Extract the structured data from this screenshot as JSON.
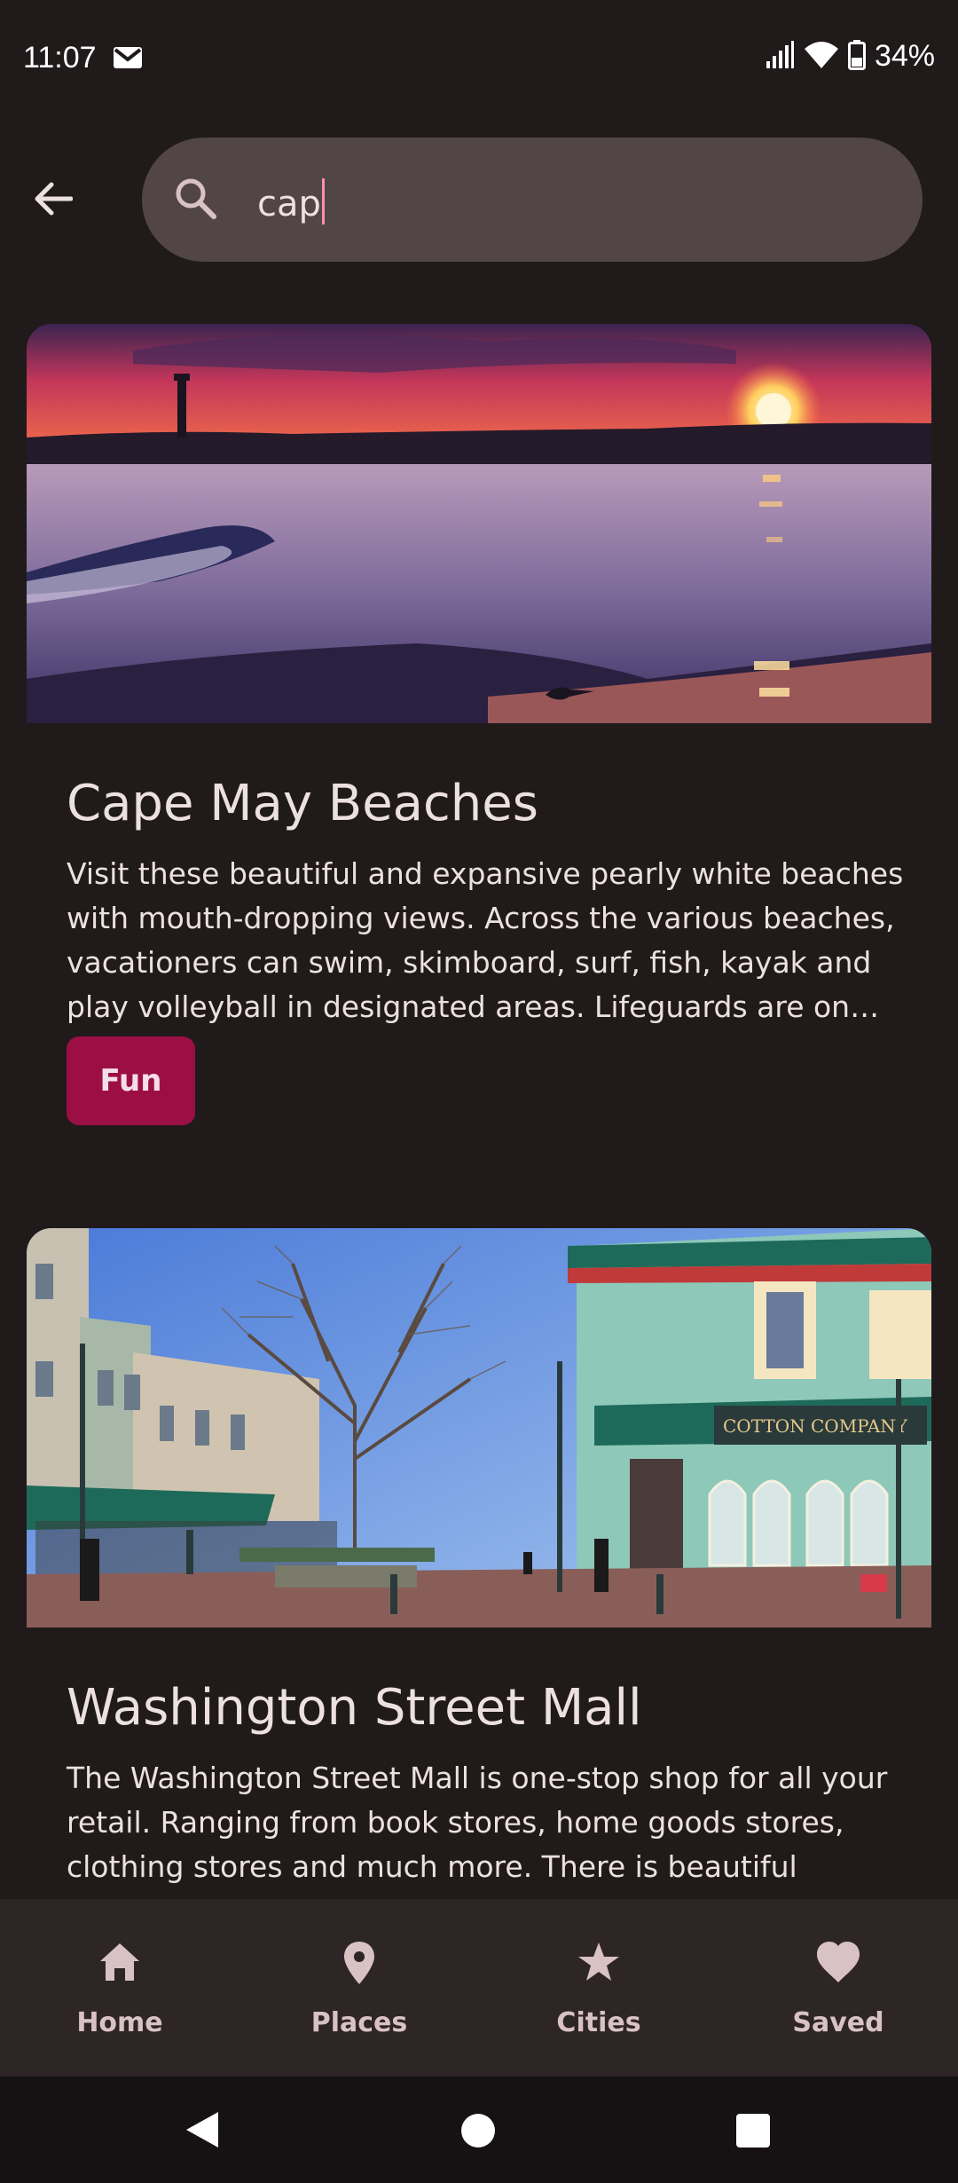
{
  "status_bar": {
    "time": "11:07",
    "battery": "34%"
  },
  "search": {
    "query": "cap",
    "placeholder": ""
  },
  "results": [
    {
      "title": "Cape May Beaches",
      "description": "Visit these beautiful and expansive pearly white beaches with mouth-dropping views. Across the various beaches, vacationers can swim, skimboard, surf, fish, kayak and play volleyball in designated areas. Lifeguards are on duty in the summer season.",
      "tag": "Fun",
      "image": "sunset-beach-with-lighthouse"
    },
    {
      "title": "Washington Street Mall",
      "description": "The Washington Street Mall is one-stop shop for all your retail. Ranging from book stores, home goods stores, clothing stores and much more. There is beautiful buildings and architecture to admire as you stroll",
      "image": "pedestrian-street-with-shops",
      "storefront_sign": "COTTON COMPANY"
    }
  ],
  "bottom_nav": {
    "items": [
      {
        "label": "Home",
        "icon": "home-icon"
      },
      {
        "label": "Places",
        "icon": "place-pin-icon"
      },
      {
        "label": "Cities",
        "icon": "star-icon"
      },
      {
        "label": "Saved",
        "icon": "heart-icon"
      }
    ]
  },
  "colors": {
    "background": "#201a1b",
    "search_bar": "#514546",
    "chip": "#9c0f45",
    "nav_bar": "#2e2526",
    "caret": "#ff8fab"
  }
}
